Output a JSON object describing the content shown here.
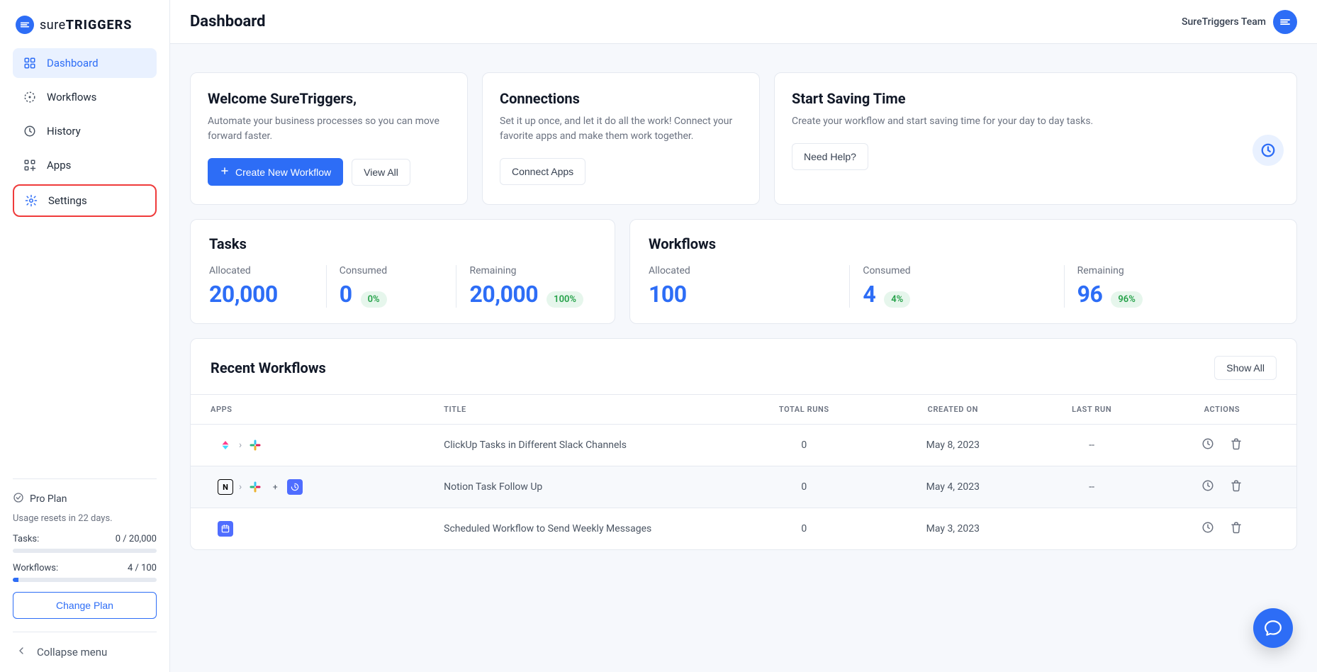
{
  "brand": {
    "prefix": "sure",
    "strong": "TRIGGERS"
  },
  "sidebar": {
    "items": [
      {
        "label": "Dashboard"
      },
      {
        "label": "Workflows"
      },
      {
        "label": "History"
      },
      {
        "label": "Apps"
      },
      {
        "label": "Settings"
      }
    ],
    "plan_name": "Pro Plan",
    "reset_text": "Usage resets in 22 days.",
    "tasks_label": "Tasks:",
    "tasks_value": "0 / 20,000",
    "tasks_fill_pct": 0,
    "workflows_label": "Workflows:",
    "workflows_value": "4 / 100",
    "workflows_fill_pct": 4,
    "change_plan": "Change Plan",
    "collapse": "Collapse menu"
  },
  "topbar": {
    "title": "Dashboard",
    "team": "SureTriggers Team"
  },
  "cards": {
    "welcome": {
      "title": "Welcome SureTriggers,",
      "text": "Automate your business processes so you can move forward faster.",
      "primary_btn": "Create New Workflow",
      "secondary_btn": "View All"
    },
    "connections": {
      "title": "Connections",
      "text": "Set it up once, and let it do all the work! Connect your favorite apps and make them work together.",
      "btn": "Connect Apps"
    },
    "saving": {
      "title": "Start Saving Time",
      "text": "Create your workflow and start saving time for your day to day tasks.",
      "btn": "Need Help?"
    }
  },
  "stats": {
    "tasks": {
      "title": "Tasks",
      "allocated_label": "Allocated",
      "allocated": "20,000",
      "consumed_label": "Consumed",
      "consumed": "0",
      "consumed_pct": "0%",
      "remaining_label": "Remaining",
      "remaining": "20,000",
      "remaining_pct": "100%"
    },
    "workflows": {
      "title": "Workflows",
      "allocated_label": "Allocated",
      "allocated": "100",
      "consumed_label": "Consumed",
      "consumed": "4",
      "consumed_pct": "4%",
      "remaining_label": "Remaining",
      "remaining": "96",
      "remaining_pct": "96%"
    }
  },
  "recent": {
    "title": "Recent Workflows",
    "show_all": "Show All",
    "columns": {
      "apps": "APPS",
      "title": "TITLE",
      "runs": "TOTAL RUNS",
      "created": "CREATED ON",
      "last": "LAST RUN",
      "actions": "ACTIONS"
    },
    "rows": [
      {
        "title": "ClickUp Tasks in Different Slack Channels",
        "runs": "0",
        "created": "May 8, 2023",
        "last": "--"
      },
      {
        "title": "Notion Task Follow Up",
        "runs": "0",
        "created": "May 4, 2023",
        "last": "--"
      },
      {
        "title": "Scheduled Workflow to Send Weekly Messages",
        "runs": "0",
        "created": "May 3, 2023",
        "last": ""
      }
    ]
  }
}
